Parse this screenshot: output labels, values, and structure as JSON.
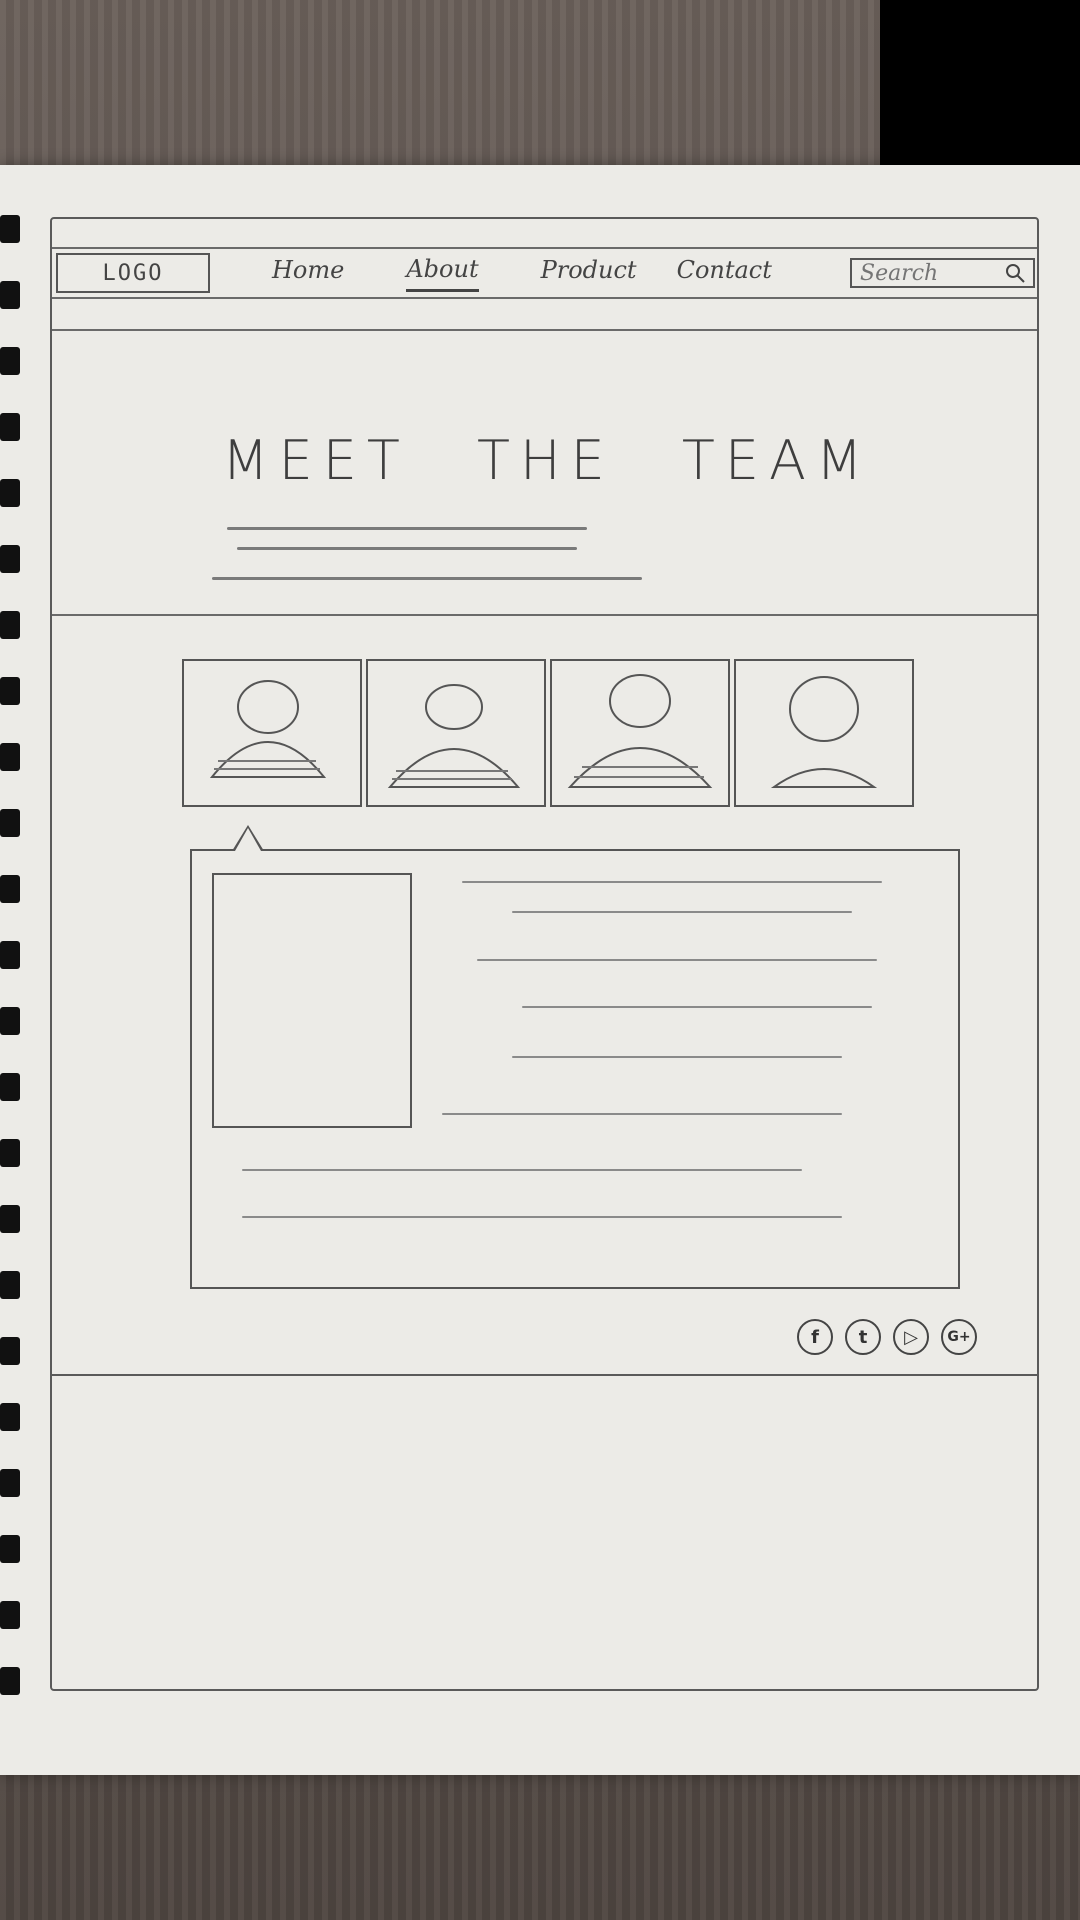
{
  "navbar": {
    "logo": "LOGO",
    "links": [
      {
        "label": "Home",
        "active": false
      },
      {
        "label": "About",
        "active": true
      },
      {
        "label": "Product",
        "active": false
      },
      {
        "label": "Contact",
        "active": false
      }
    ],
    "search_placeholder": "Search",
    "search_icon": "search-icon"
  },
  "hero": {
    "title": "MEET THE TEAM"
  },
  "team": {
    "member_count": 4,
    "selected_index": 0,
    "avatar_icon": "person-icon"
  },
  "socials": [
    {
      "label": "f",
      "icon": "facebook-icon"
    },
    {
      "label": "t",
      "icon": "twitter-icon"
    },
    {
      "label": "▷",
      "icon": "youtube-icon"
    },
    {
      "label": "G+",
      "icon": "google-plus-icon"
    }
  ],
  "colors": {
    "paper": "#ecebe7",
    "pencil": "#555555",
    "desk": "#5b514c"
  }
}
